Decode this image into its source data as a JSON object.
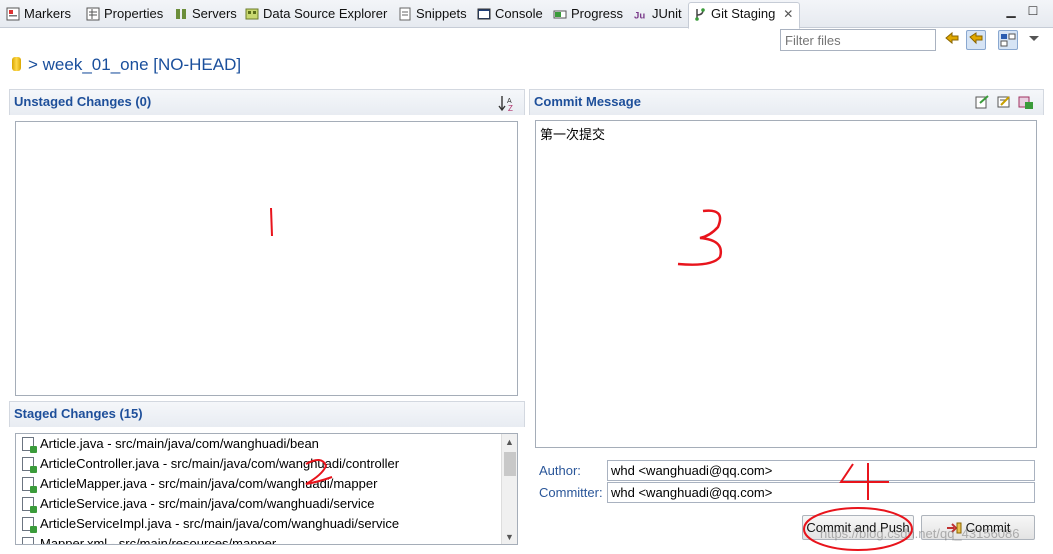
{
  "tabs": [
    {
      "label": "Markers",
      "icon": "markers-icon"
    },
    {
      "label": "Properties",
      "icon": "properties-icon"
    },
    {
      "label": "Servers",
      "icon": "servers-icon"
    },
    {
      "label": "Data Source Explorer",
      "icon": "data-source-icon"
    },
    {
      "label": "Snippets",
      "icon": "snippets-icon"
    },
    {
      "label": "Console",
      "icon": "console-icon"
    },
    {
      "label": "Progress",
      "icon": "progress-icon"
    },
    {
      "label": "JUnit",
      "icon": "junit-icon"
    },
    {
      "label": "Git Staging",
      "icon": "git-staging-icon",
      "active": true,
      "close": "✕"
    }
  ],
  "toolbar": {
    "filter_placeholder": "Filter files"
  },
  "repo_title": "> week_01_one [NO-HEAD]",
  "unstaged": {
    "title": "Unstaged Changes (0)"
  },
  "staged": {
    "title": "Staged Changes (15)",
    "files": [
      "Article.java - src/main/java/com/wanghuadi/bean",
      "ArticleController.java - src/main/java/com/wanghuadi/controller",
      "ArticleMapper.java - src/main/java/com/wanghuadi/mapper",
      "ArticleService.java - src/main/java/com/wanghuadi/service",
      "ArticleServiceImpl.java - src/main/java/com/wanghuadi/service",
      "Mapper.xml - src/main/resources/mapper"
    ]
  },
  "commit": {
    "title": "Commit Message",
    "message": "第一次提交",
    "author_label": "Author:",
    "author_value": "whd <wanghuadi@qq.com>",
    "committer_label": "Committer:",
    "committer_value": "whd <wanghuadi@qq.com>",
    "commit_push_label": "Commit and Push",
    "commit_label": "Commit"
  },
  "watermark": "https://blog.csdn.net/qq_43156086",
  "colors": {
    "accent": "#1e4f9a",
    "annotation": "#e8141c"
  }
}
